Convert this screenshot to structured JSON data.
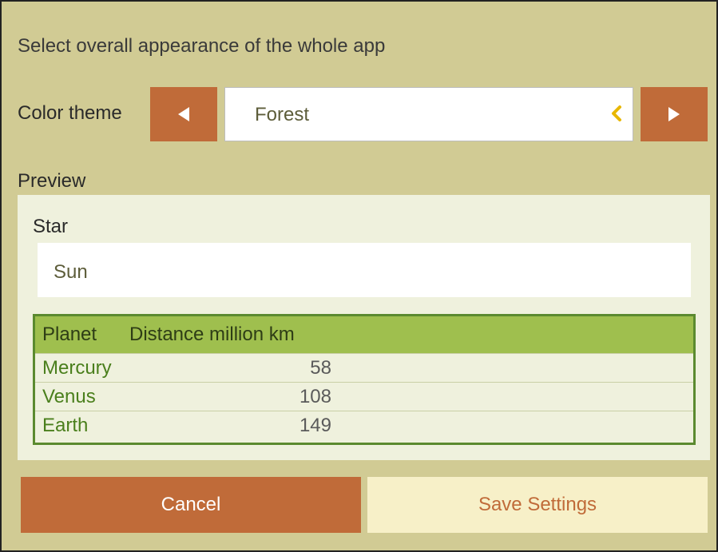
{
  "heading": "Select overall appearance of the whole app",
  "theme": {
    "label": "Color theme",
    "value": "Forest",
    "prev_icon": "triangle-left-icon",
    "next_icon": "triangle-right-icon",
    "dropdown_icon": "chevron-left-icon"
  },
  "preview": {
    "label": "Preview",
    "star_label": "Star",
    "star_value": "Sun",
    "table": {
      "headers": [
        "Planet",
        "Distance million km"
      ],
      "rows": [
        [
          "Mercury",
          "58"
        ],
        [
          "Venus",
          "108"
        ],
        [
          "Earth",
          "149"
        ]
      ]
    }
  },
  "buttons": {
    "cancel": "Cancel",
    "save": "Save Settings"
  },
  "colors": {
    "background": "#d1cb94",
    "accent": "#c06b39",
    "grid_header": "#9fbf4e",
    "grid_border": "#5b8a2f",
    "chevron": "#e8b700"
  }
}
